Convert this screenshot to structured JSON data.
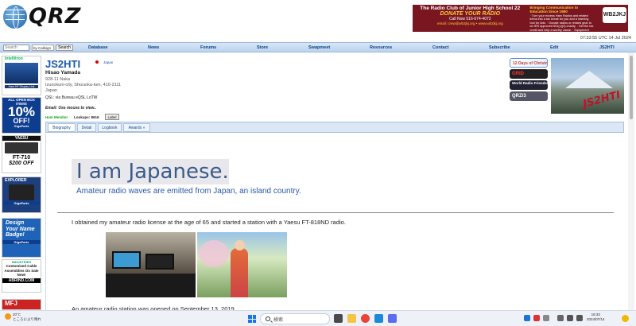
{
  "header": {
    "logo_text": "QRZ",
    "banner": {
      "line1": "The Radio Club of Junior High School 22",
      "line2": "DONATE YOUR RADIO",
      "line3": "Call Now 516-674-4072",
      "line4": "email: crew@wb2jkj.org • www.wb2jkj.org",
      "right_title": "Bringing Communication to Education Since 1980",
      "right_body": "· Turn your excess Ham Radios and related items into a tax break for you and a learning tool for kids. · Donate radios or related gear to an IRS approved 501(c)(3) charity. · Get the tax credit and help a worthy cause. · Equipment picked up anywhere or shipped.",
      "badge": "WB2JKJ"
    },
    "datetime": "07:33:55 UTC 14 Jul 2024"
  },
  "nav": {
    "search_placeholder": "Search",
    "search_by": "by Callsign",
    "search_button": "Search",
    "items": [
      "Database",
      "News",
      "Forums",
      "Store",
      "Swapmeet",
      "Resources",
      "Contact",
      "Subscribe",
      "Edit",
      "JS2HTI"
    ]
  },
  "sidebar": {
    "ad1_brand": "Intellitron",
    "ad1_caption": "Ham HF Display Unit",
    "ad2_top": "ALL OPEN BOX ITEMS",
    "ad2_big": "10%",
    "ad2_off": "OFF!",
    "ad3_header": "YAESU",
    "ad3_model": "FT-710",
    "ad3_price": "$200 OFF",
    "ad4_title": "EXPLORER",
    "ad5_text": "Design Your Name Badge!",
    "ad6_logo": "INDUSTRIES",
    "ad6_text": "Customized Cable Assemblies On Sale Now!",
    "ad6_bar": "ABRIND.COM",
    "ad7_text": "MFJ",
    "gigaparts": "GigaParts"
  },
  "profile": {
    "callsign": "JS2HTI",
    "country": "Japan",
    "name": "Hisao Yamada",
    "address1": "928-11 Naka",
    "address2": "Izunokuni-city, Shizuoka-ken, 410-2111",
    "address3": "Japan",
    "qsl": "QSL: via Bureau eQSL LoTW",
    "email": "Email: Use mouse to view..",
    "member": "Ham Member",
    "lookups": "Lookups: 8616",
    "label_button": "Label",
    "badges": [
      "12 Days of Christmas",
      "GRID",
      "World Radio Friendship",
      "QRZ/3"
    ],
    "photo_text": "JS2HTI"
  },
  "tabs": [
    "Biography",
    "Detail",
    "Logbook",
    "Awards »"
  ],
  "content": {
    "headline": "I am Japanese.",
    "subtitle": "Amateur radio waves are emitted from Japan, an island country.",
    "paragraph": "I obtained my amateur radio license at the age of 65 and started a station with a Yaesu FT-818ND radio.",
    "next_line": "An amateur radio station was opened on September 13, 2019."
  },
  "taskbar": {
    "weather_temp": "30°C",
    "weather_desc": "ところにより晴れ",
    "search_text": "検索",
    "time": "16:33",
    "date": "2024/07/14"
  }
}
